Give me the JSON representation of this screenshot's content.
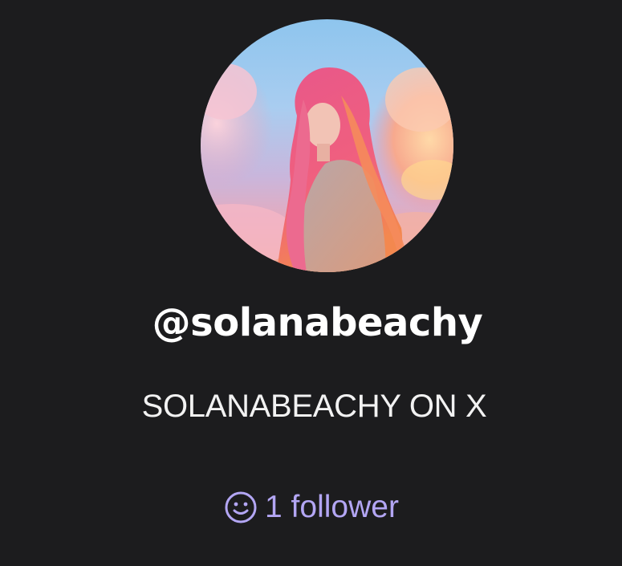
{
  "profile": {
    "avatar_icon": "profile-photo",
    "username": "@solanabeachy",
    "subtitle": "SOLANABEACHY ON X",
    "followers": {
      "icon": "smiley-face-icon",
      "label": "1 follower"
    }
  },
  "colors": {
    "background": "#1c1c1e",
    "username": "#ffffff",
    "subtitle": "#f2f2f2",
    "accent": "#b3a6f4"
  }
}
